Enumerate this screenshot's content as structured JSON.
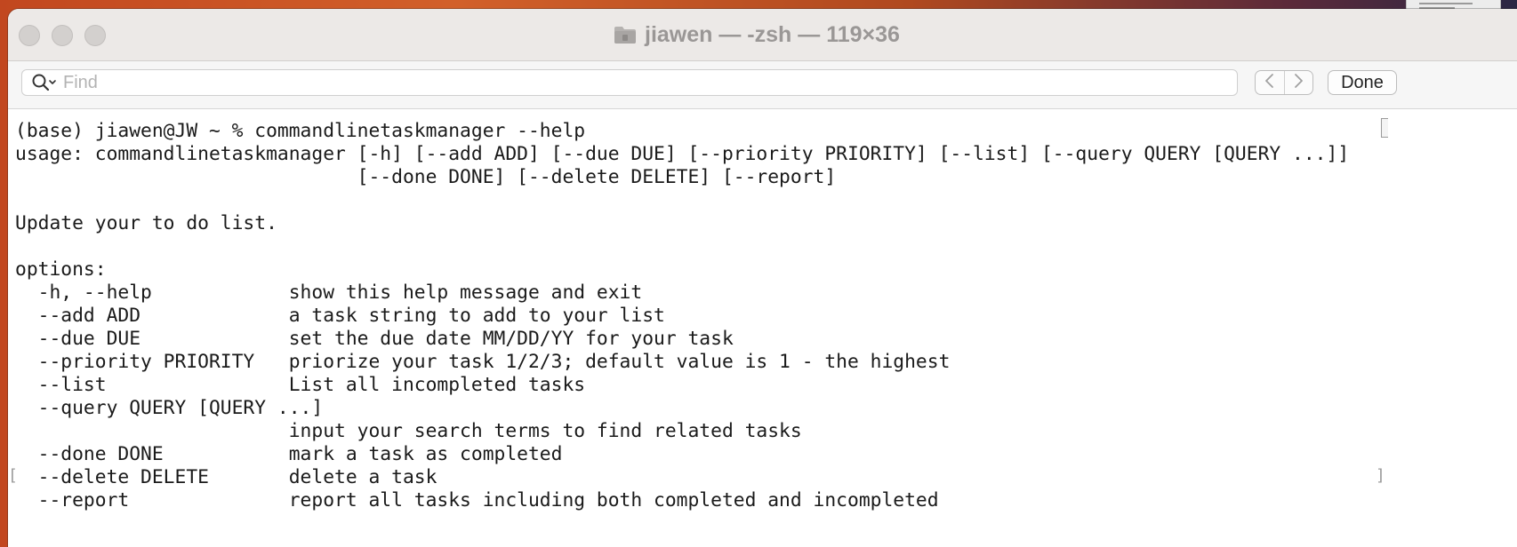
{
  "window": {
    "title": "jiawen — -zsh — 119×36"
  },
  "icons": {
    "folder": "folder-icon",
    "search": "search-icon",
    "previous": "chevron-left-icon",
    "next": "chevron-right-icon"
  },
  "findbar": {
    "placeholder": "Find",
    "done_label": "Done"
  },
  "terminal": {
    "lines": [
      "(base) jiawen@JW ~ % commandlinetaskmanager --help",
      "usage: commandlinetaskmanager [-h] [--add ADD] [--due DUE] [--priority PRIORITY] [--list] [--query QUERY [QUERY ...]]",
      "                              [--done DONE] [--delete DELETE] [--report]",
      "",
      "Update your to do list.",
      "",
      "options:",
      "  -h, --help            show this help message and exit",
      "  --add ADD             a task string to add to your list",
      "  --due DUE             set the due date MM/DD/YY for your task",
      "  --priority PRIORITY   priorize your task 1/2/3; default value is 1 - the highest",
      "  --list                List all incompleted tasks",
      "  --query QUERY [QUERY ...]",
      "                        input your search terms to find related tasks",
      "  --done DONE           mark a task as completed",
      "  --delete DELETE       delete a task",
      "  --report              report all tasks including both completed and incompleted"
    ]
  },
  "colors": {
    "titlebar": "#ece9e7",
    "title_text": "#9a9796",
    "terminal_bg": "#ffffff",
    "terminal_text": "#1a1a1a"
  }
}
